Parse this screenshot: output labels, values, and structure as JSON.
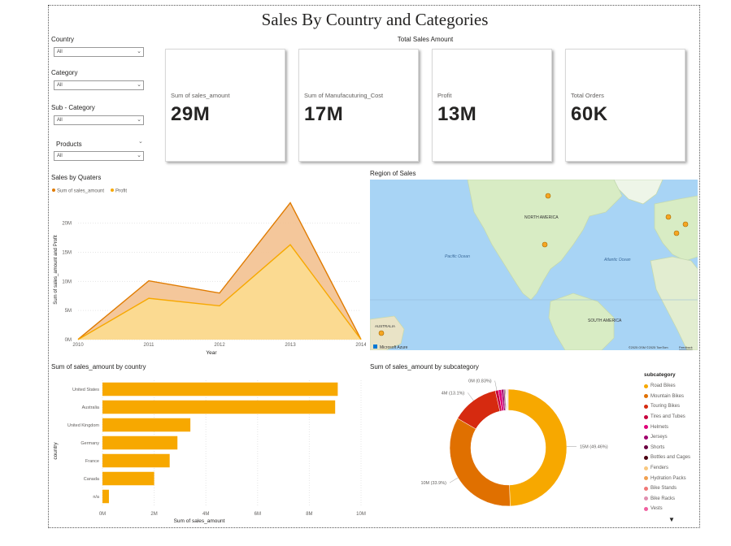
{
  "title": "Sales By Country and Categories",
  "slicers": [
    {
      "label": "Country",
      "value": "All"
    },
    {
      "label": "Category",
      "value": "All"
    },
    {
      "label": "Sub - Category",
      "value": "All"
    },
    {
      "label": "Products",
      "value": "All"
    }
  ],
  "cards_header": "Total Sales Amount",
  "cards": [
    {
      "label": "Sum of sales_amount",
      "value": "29M"
    },
    {
      "label": "Sum of Manufacuturing_Cost",
      "value": "17M"
    },
    {
      "label": "Profit",
      "value": "13M"
    },
    {
      "label": "Total Orders",
      "value": "60K"
    }
  ],
  "area_title": "Sales by Quaters",
  "map": {
    "title": "Region of Sales",
    "labels": {
      "north_america": "NORTH AMERICA",
      "pacific": "Pacific Ocean",
      "atlantic": "Atlantic Ocean",
      "south_america": "SOUTH AMERICA",
      "australia": "AUSTRALIA"
    },
    "logo": "Microsoft Azure",
    "copyright": "©2025 OSM ©2025 TomTom",
    "feedback": "Feedback",
    "colors": {
      "water": "#a8d4f5",
      "land": "#d8ecc4",
      "marker": "#f5a623"
    }
  },
  "bar_title": "Sum of sales_amount by country",
  "donut_title": "Sum of sales_amount by subcategory",
  "legend": {
    "title": "subcategory",
    "items": [
      {
        "name": "Road Bikes",
        "color": "#f7a800"
      },
      {
        "name": "Mountain Bikes",
        "color": "#e07000"
      },
      {
        "name": "Touring Bikes",
        "color": "#d62a10"
      },
      {
        "name": "Tires and Tubes",
        "color": "#c8003c"
      },
      {
        "name": "Helmets",
        "color": "#e0007a"
      },
      {
        "name": "Jerseys",
        "color": "#a0006e"
      },
      {
        "name": "Shorts",
        "color": "#6a0040"
      },
      {
        "name": "Bottles and Cages",
        "color": "#4a0010"
      },
      {
        "name": "Fenders",
        "color": "#f8c880"
      },
      {
        "name": "Hydration Packs",
        "color": "#f0a050"
      },
      {
        "name": "Bike Stands",
        "color": "#f07878"
      },
      {
        "name": "Bike Racks",
        "color": "#e090b0"
      },
      {
        "name": "Vests",
        "color": "#f060a0"
      }
    ]
  },
  "chart_data": [
    {
      "type": "area",
      "title": "Sales by Quaters",
      "xlabel": "Year",
      "ylabel": "Sum of sales_amount and Profit",
      "x": [
        2010,
        2011,
        2012,
        2013,
        2014
      ],
      "xticks": [
        "2010",
        "2011",
        "2012",
        "2013",
        "2014"
      ],
      "yticks": [
        "0M",
        "5M",
        "10M",
        "15M",
        "20M"
      ],
      "ylim": [
        0,
        24
      ],
      "legend_position": "top-left",
      "series": [
        {
          "name": "Sum of sales_amount",
          "values": [
            0.04,
            10.1,
            8.0,
            23.5,
            0.05
          ],
          "color": "#e07b00",
          "fill": "#f3c190"
        },
        {
          "name": "Profit",
          "values": [
            0.02,
            7.1,
            5.8,
            16.3,
            0.02
          ],
          "color": "#f7a800",
          "fill": "#fcdc90"
        }
      ]
    },
    {
      "type": "bar",
      "title": "Sum of sales_amount by country",
      "xlabel": "Sum of sales_amount",
      "ylabel": "country",
      "categories": [
        "United States",
        "Australia",
        "United Kingdom",
        "Germany",
        "France",
        "Canada",
        "n/a"
      ],
      "values": [
        9.1,
        9.0,
        3.4,
        2.9,
        2.6,
        2.0,
        0.25
      ],
      "xticks": [
        "0M",
        "2M",
        "4M",
        "6M",
        "8M",
        "10M"
      ],
      "xlim": [
        0,
        10
      ],
      "color": "#f7a800"
    },
    {
      "type": "pie",
      "title": "Sum of sales_amount by subcategory",
      "labels": [
        "Road Bikes",
        "Mountain Bikes",
        "Touring Bikes",
        "Tires and Tubes",
        "Helmets",
        "Jerseys",
        "Shorts",
        "Bottles and Cages",
        "Fenders",
        "Hydration Packs",
        "Bike Stands",
        "Bike Racks",
        "Vests"
      ],
      "values": [
        49.46,
        33.9,
        13.1,
        0.83,
        0.85,
        0.6,
        0.3,
        0.2,
        0.15,
        0.15,
        0.15,
        0.15,
        0.16
      ],
      "data_labels": [
        {
          "category": "Road Bikes",
          "text": "15M (49.46%)"
        },
        {
          "category": "Mountain Bikes",
          "text": "10M (33.9%)"
        },
        {
          "category": "Touring Bikes",
          "text": "4M (13.1%)"
        },
        {
          "category": "Tires and Tubes",
          "text": "0M (0.83%)"
        }
      ]
    }
  ]
}
